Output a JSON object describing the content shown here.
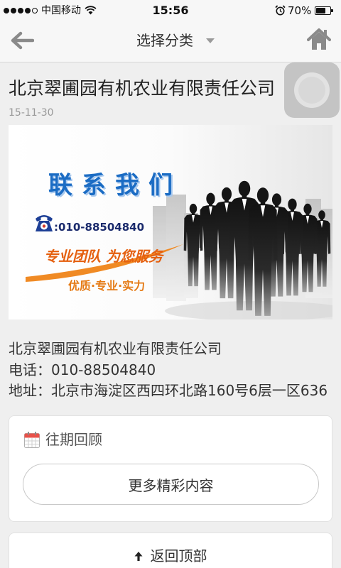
{
  "status_bar": {
    "carrier": "中国移动",
    "time": "15:56",
    "battery_label": "70%",
    "battery_level": 0.7,
    "signal_level": 4,
    "signal_max": 5,
    "icons": {
      "wifi": "wifi-icon",
      "alarm": "alarm-clock-icon",
      "battery": "battery-icon"
    }
  },
  "nav": {
    "title": "选择分类",
    "back_icon": "back-arrow-icon",
    "dropdown_icon": "caret-down-icon",
    "home_icon": "home-icon"
  },
  "article": {
    "title": "北京翠圃园有机农业有限责任公司",
    "date": "15-11-30",
    "banner": {
      "heading": "联系我们",
      "phone": ":010-88504840",
      "slogan": "专业团队 为您服务",
      "tagline": "优质·专业·实力"
    },
    "info": {
      "company": "北京翠圃园有机农业有限责任公司",
      "phone": "电话：010-88504840",
      "address": "地址：北京市海淀区西四环北路160号6层一区636"
    }
  },
  "past_issues": {
    "icon": "calendar-icon",
    "heading": "往期回顾",
    "more_button": "更多精彩内容"
  },
  "back_to_top": {
    "icon": "arrow-up-icon",
    "label": "返回顶部"
  },
  "colors": {
    "page_background": "#efefef",
    "banner_blue": "#1b6cc4",
    "banner_orange": "#e5600f"
  }
}
